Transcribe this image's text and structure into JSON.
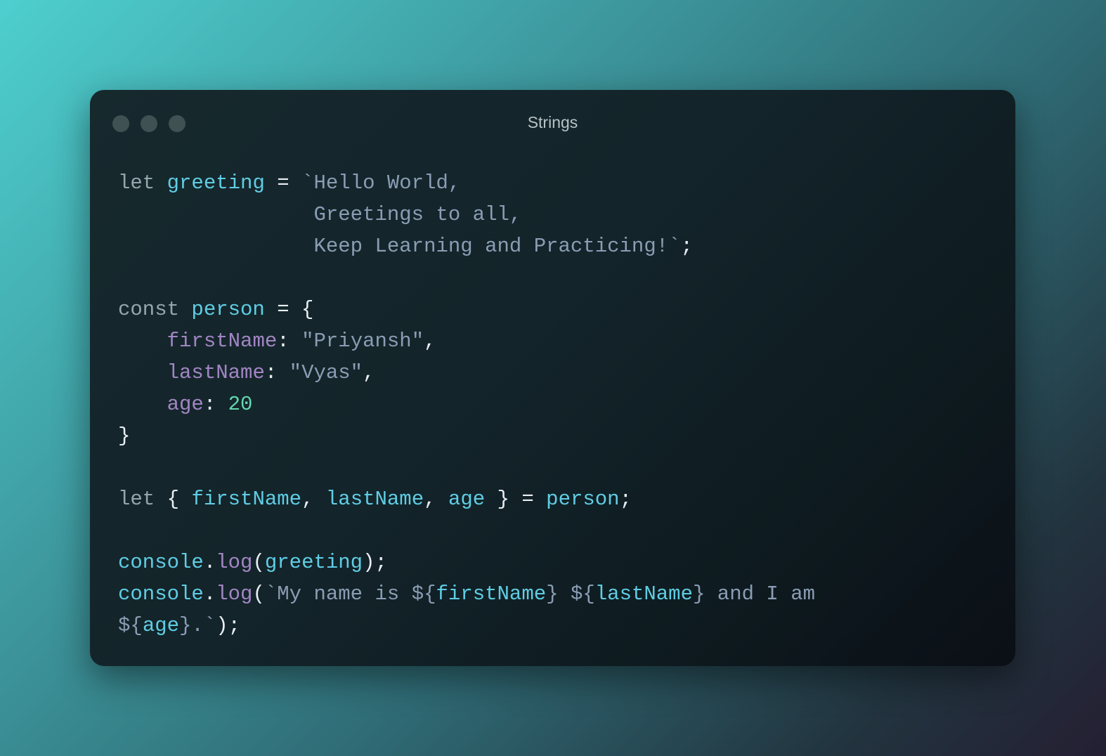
{
  "window": {
    "title": "Strings"
  },
  "code_lines": [
    [
      {
        "t": "let",
        "c": "kw"
      },
      {
        "t": " ",
        "c": "pun"
      },
      {
        "t": "greeting",
        "c": "var"
      },
      {
        "t": " = ",
        "c": "pun"
      },
      {
        "t": "`Hello World,",
        "c": "str"
      }
    ],
    [
      {
        "t": "                Greetings to all,",
        "c": "str"
      }
    ],
    [
      {
        "t": "                Keep Learning and Practicing!`",
        "c": "str"
      },
      {
        "t": ";",
        "c": "pun"
      }
    ],
    [],
    [
      {
        "t": "const",
        "c": "kw"
      },
      {
        "t": " ",
        "c": "pun"
      },
      {
        "t": "person",
        "c": "var"
      },
      {
        "t": " = {",
        "c": "pun"
      }
    ],
    [
      {
        "t": "    ",
        "c": "pun"
      },
      {
        "t": "firstName",
        "c": "prop"
      },
      {
        "t": ": ",
        "c": "pun"
      },
      {
        "t": "\"Priyansh\"",
        "c": "str"
      },
      {
        "t": ",",
        "c": "pun"
      }
    ],
    [
      {
        "t": "    ",
        "c": "pun"
      },
      {
        "t": "lastName",
        "c": "prop"
      },
      {
        "t": ": ",
        "c": "pun"
      },
      {
        "t": "\"Vyas\"",
        "c": "str"
      },
      {
        "t": ",",
        "c": "pun"
      }
    ],
    [
      {
        "t": "    ",
        "c": "pun"
      },
      {
        "t": "age",
        "c": "prop"
      },
      {
        "t": ": ",
        "c": "pun"
      },
      {
        "t": "20",
        "c": "num"
      }
    ],
    [
      {
        "t": "}",
        "c": "pun"
      }
    ],
    [],
    [
      {
        "t": "let",
        "c": "kw"
      },
      {
        "t": " { ",
        "c": "pun"
      },
      {
        "t": "firstName",
        "c": "var"
      },
      {
        "t": ", ",
        "c": "pun"
      },
      {
        "t": "lastName",
        "c": "var"
      },
      {
        "t": ", ",
        "c": "pun"
      },
      {
        "t": "age",
        "c": "var"
      },
      {
        "t": " } = ",
        "c": "pun"
      },
      {
        "t": "person",
        "c": "var"
      },
      {
        "t": ";",
        "c": "pun"
      }
    ],
    [],
    [
      {
        "t": "console",
        "c": "var"
      },
      {
        "t": ".",
        "c": "pun"
      },
      {
        "t": "log",
        "c": "prop"
      },
      {
        "t": "(",
        "c": "pun"
      },
      {
        "t": "greeting",
        "c": "var"
      },
      {
        "t": ");",
        "c": "pun"
      }
    ],
    [
      {
        "t": "console",
        "c": "var"
      },
      {
        "t": ".",
        "c": "pun"
      },
      {
        "t": "log",
        "c": "prop"
      },
      {
        "t": "(",
        "c": "pun"
      },
      {
        "t": "`My name is ${",
        "c": "str"
      },
      {
        "t": "firstName",
        "c": "var"
      },
      {
        "t": "} ${",
        "c": "str"
      },
      {
        "t": "lastName",
        "c": "var"
      },
      {
        "t": "} and I am",
        "c": "str"
      }
    ],
    [
      {
        "t": "${",
        "c": "str"
      },
      {
        "t": "age",
        "c": "var"
      },
      {
        "t": "}.`",
        "c": "str"
      },
      {
        "t": ");",
        "c": "pun"
      }
    ]
  ]
}
